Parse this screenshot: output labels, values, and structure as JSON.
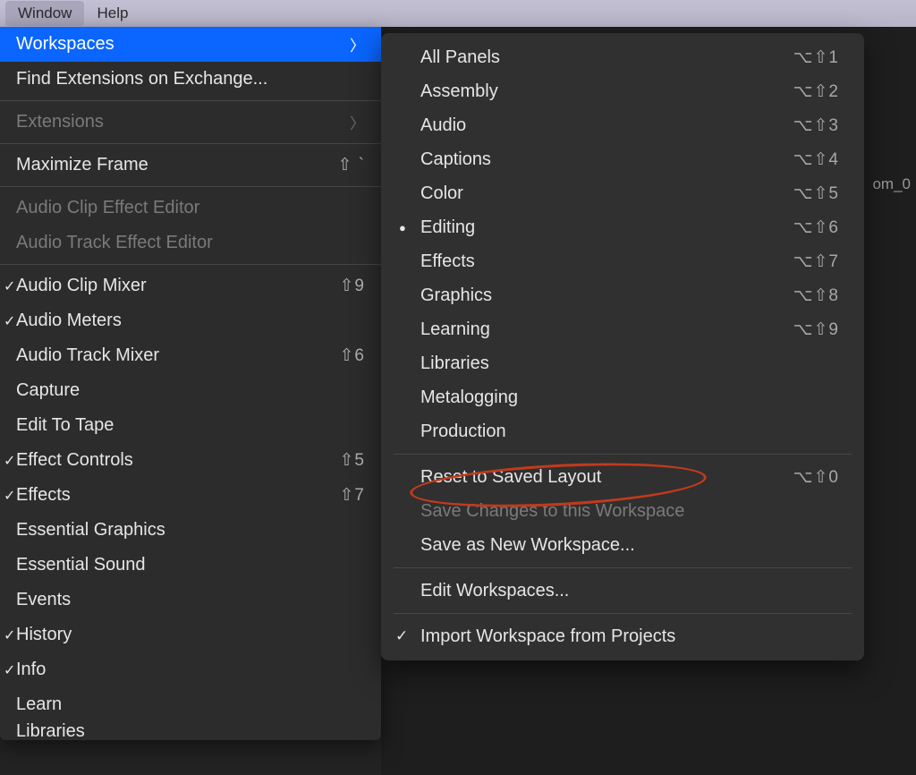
{
  "menubar": {
    "window": "Window",
    "help": "Help"
  },
  "bg": {
    "tag": "om_0"
  },
  "windowMenu": {
    "workspaces": {
      "label": "Workspaces"
    },
    "findExt": {
      "label": "Find Extensions on Exchange..."
    },
    "extensions": {
      "label": "Extensions"
    },
    "maximize": {
      "label": "Maximize Frame",
      "shortcut": "⇧ `"
    },
    "audioClipEffect": {
      "label": "Audio Clip Effect Editor"
    },
    "audioTrackEffect": {
      "label": "Audio Track Effect Editor"
    },
    "audioClipMixer": {
      "label": "Audio Clip Mixer",
      "shortcut": "⇧9"
    },
    "audioMeters": {
      "label": "Audio Meters"
    },
    "audioTrackMixer": {
      "label": "Audio Track Mixer",
      "shortcut": "⇧6"
    },
    "capture": {
      "label": "Capture"
    },
    "editToTape": {
      "label": "Edit To Tape"
    },
    "effectControls": {
      "label": "Effect Controls",
      "shortcut": "⇧5"
    },
    "effects": {
      "label": "Effects",
      "shortcut": "⇧7"
    },
    "essentialGraphics": {
      "label": "Essential Graphics"
    },
    "essentialSound": {
      "label": "Essential Sound"
    },
    "events": {
      "label": "Events"
    },
    "history": {
      "label": "History"
    },
    "info": {
      "label": "Info"
    },
    "learn": {
      "label": "Learn"
    },
    "libraries": {
      "label": "Libraries"
    }
  },
  "workspacesSubmenu": {
    "allPanels": {
      "label": "All Panels",
      "shortcut": "⌥⇧1"
    },
    "assembly": {
      "label": "Assembly",
      "shortcut": "⌥⇧2"
    },
    "audio": {
      "label": "Audio",
      "shortcut": "⌥⇧3"
    },
    "captions": {
      "label": "Captions",
      "shortcut": "⌥⇧4"
    },
    "color": {
      "label": "Color",
      "shortcut": "⌥⇧5"
    },
    "editing": {
      "label": "Editing",
      "shortcut": "⌥⇧6"
    },
    "effects": {
      "label": "Effects",
      "shortcut": "⌥⇧7"
    },
    "graphics": {
      "label": "Graphics",
      "shortcut": "⌥⇧8"
    },
    "learning": {
      "label": "Learning",
      "shortcut": "⌥⇧9"
    },
    "libraries": {
      "label": "Libraries"
    },
    "metalogging": {
      "label": "Metalogging"
    },
    "production": {
      "label": "Production"
    },
    "reset": {
      "label": "Reset to Saved Layout",
      "shortcut": "⌥⇧0"
    },
    "saveChanges": {
      "label": "Save Changes to this Workspace"
    },
    "saveNew": {
      "label": "Save as New Workspace..."
    },
    "editWs": {
      "label": "Edit Workspaces..."
    },
    "import": {
      "label": "Import Workspace from Projects"
    }
  }
}
